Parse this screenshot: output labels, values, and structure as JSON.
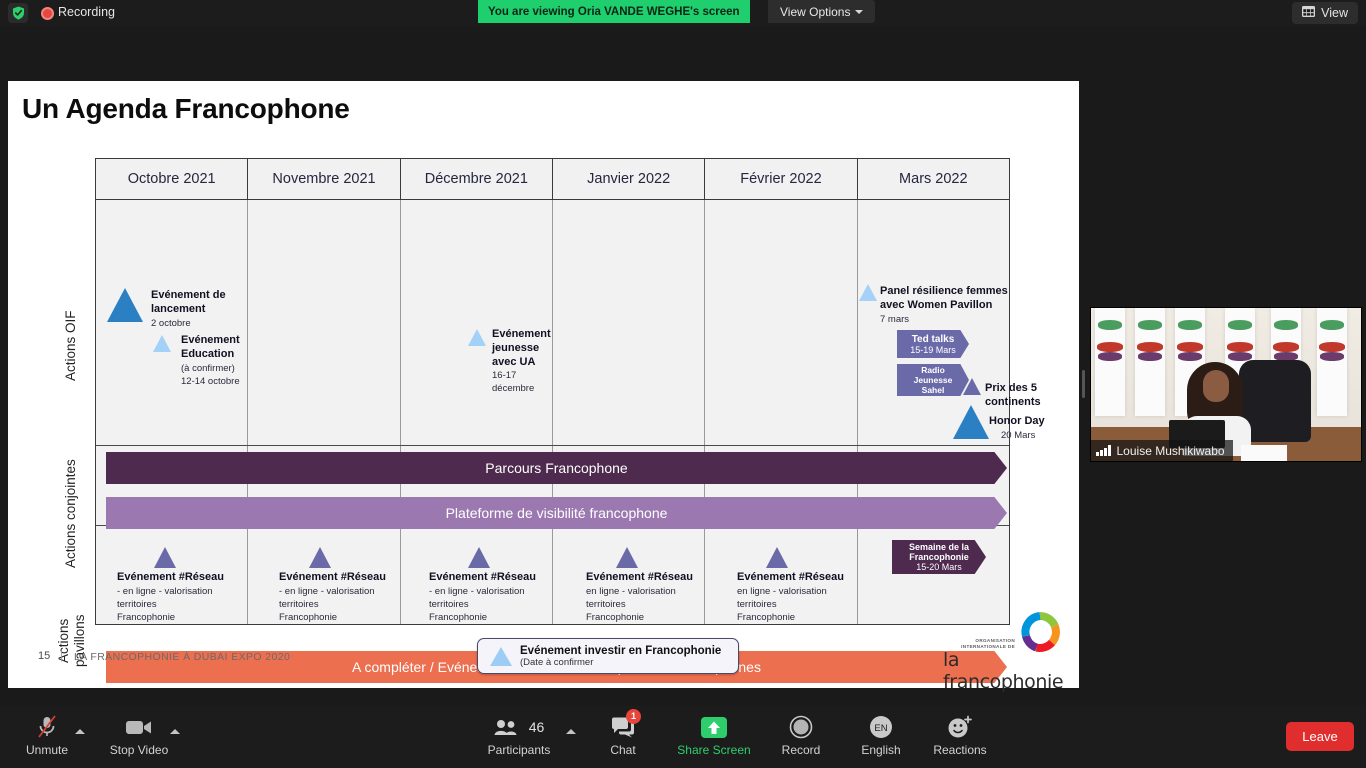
{
  "topbar": {
    "shield_icon": "shield-check-icon",
    "recording_icon": "record-dot-icon",
    "recording_label": "Recording",
    "viewing_banner": "You are viewing Oria VANDE WEGHE's screen",
    "view_options_label": "View Options",
    "view_button_label": "View",
    "view_button_icon": "grid-view-icon",
    "banner_color": "#1fce6d"
  },
  "slide": {
    "title": "Un Agenda Francophone",
    "row_labels": {
      "oif": "Actions OIF",
      "conjointes": "Actions conjointes",
      "pavillons_line1": "Actions",
      "pavillons_line2": "pavillons"
    },
    "columns": [
      "Octobre 2021",
      "Novembre 2021",
      "Décembre 2021",
      "Janvier 2022",
      "Février 2022",
      "Mars 2022"
    ],
    "oif_events": {
      "lancement": {
        "title_l1": "Evénement de",
        "title_l2": "lancement",
        "date": "2 octobre"
      },
      "education": {
        "title_l1": "Evénement",
        "title_l2": "Education",
        "note": "(à confirmer)",
        "date": "12-14 octobre"
      },
      "jeunesse": {
        "title_l1": "Evénement",
        "title_l2": "jeunesse",
        "title_l3": "avec UA",
        "date_l1": "16-17",
        "date_l2": "décembre"
      },
      "panel": {
        "title_l1": "Panel résilience femmes",
        "title_l2": "avec Women Pavillon",
        "date": "7 mars"
      },
      "ted_talks": {
        "label": "Ted talks",
        "date": "15-19 Mars"
      },
      "radio": {
        "label_l1": "Radio",
        "label_l2": "Jeunesse",
        "label_l3": "Sahel"
      },
      "prix": {
        "title_l1": "Prix des 5",
        "title_l2": "continents"
      },
      "honor": {
        "title": "Honor Day",
        "date": "20 Mars"
      }
    },
    "bars": {
      "parcours": {
        "label": "Parcours Francophone",
        "color": "#4d2a4e"
      },
      "plateforme": {
        "label": "Plateforme de visibilité francophone",
        "color": "#9b79b0"
      },
      "completer": {
        "label": "A compléter / Evénements à l'initiative des pavillons francophones",
        "color": "#ec6f50"
      }
    },
    "reseau_events": [
      {
        "title": "Evénement #Réseau",
        "l1": "- en ligne - valorisation",
        "l2": "territoires",
        "l3": "Francophonie"
      },
      {
        "title": "Evénement #Réseau",
        "l1": "- en ligne - valorisation",
        "l2": "territoires",
        "l3": "Francophonie"
      },
      {
        "title": "Evénement  #Réseau",
        "l1": "- en ligne - valorisation",
        "l2": "territoires",
        "l3": "Francophonie"
      },
      {
        "title": "Evénement #Réseau",
        "l1": "en ligne - valorisation",
        "l2": "territoires",
        "l3": "Francophonie"
      },
      {
        "title": "Evénement #Réseau",
        "l1": "en ligne - valorisation",
        "l2": "territoires",
        "l3": "Francophonie"
      }
    ],
    "semaine_badge": {
      "l1": "Semaine de la",
      "l2": "Francophonie",
      "date": "15-20 Mars",
      "color": "#4d2a4e"
    },
    "legend": {
      "title": "Evénement investir en Francophonie",
      "note": "(Date à confirmer"
    },
    "footer": {
      "page": "15",
      "separator": "|",
      "text": "LA FRANCOPHONIE À DUBAI EXPO 2020"
    },
    "logo": {
      "sub_l1": "ORGANISATION",
      "sub_l2": "INTERNATIONALE DE",
      "word": "la francophonie"
    }
  },
  "video": {
    "participant_name": "Louise Mushikiwabo",
    "signal_icon": "signal-bars-icon"
  },
  "toolbar": {
    "mute": {
      "label": "Unmute",
      "icon": "microphone-muted-icon"
    },
    "video": {
      "label": "Stop Video",
      "icon": "camera-icon"
    },
    "participants": {
      "label": "Participants",
      "count": "46",
      "icon": "people-icon"
    },
    "chat": {
      "label": "Chat",
      "badge": "1",
      "icon": "chat-bubble-icon"
    },
    "share": {
      "label": "Share Screen",
      "icon": "share-arrow-up-icon",
      "color": "#2fce6d"
    },
    "record": {
      "label": "Record",
      "icon": "record-circle-icon"
    },
    "language": {
      "label": "English",
      "icon": "language-en-icon"
    },
    "reactions": {
      "label": "Reactions",
      "icon": "smiley-plus-icon"
    },
    "leave": {
      "label": "Leave",
      "color": "#e02d2d"
    }
  }
}
